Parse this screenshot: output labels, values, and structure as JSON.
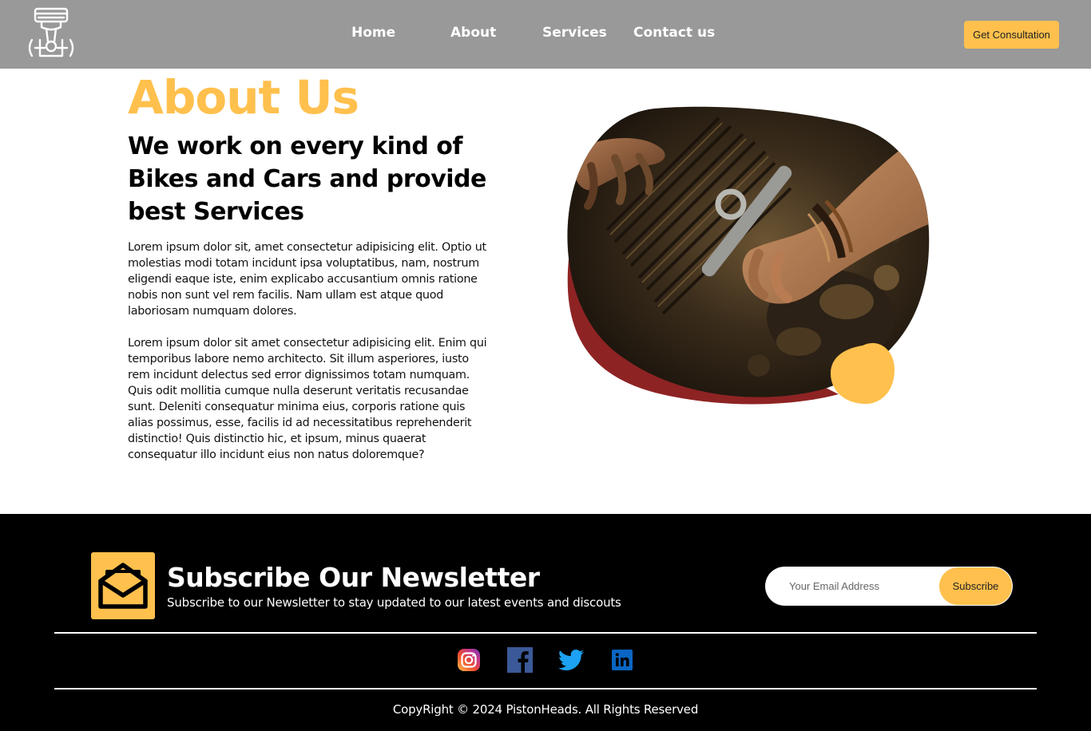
{
  "nav": {
    "logo_icon": "piston-engine-icon",
    "links": [
      "Home",
      "About",
      "Services",
      "Contact us"
    ],
    "cta_label": "Get Consultation"
  },
  "about": {
    "title": "About Us",
    "subtitle": "We work on every kind of Bikes and Cars and provide best Services",
    "paragraph1": "Lorem ipsum dolor sit, amet consectetur adipisicing elit. Optio ut molestias modi totam incidunt ipsa voluptatibus, nam, nostrum eligendi eaque iste, enim explicabo accusantium omnis ratione nobis non sunt vel rem facilis. Nam ullam est atque quod laboriosam numquam dolores.",
    "paragraph2": "Lorem ipsum dolor sit amet consectetur adipisicing elit. Enim qui temporibus labore nemo architecto. Sit illum asperiores, iusto rem incidunt delectus sed error dignissimos totam numquam. Quis odit mollitia cumque nulla deserunt veritatis recusandae sunt. Deleniti consequatur minima eius, corporis ratione quis alias possimus, esse, facilis id ad necessitatibus reprehenderit distinctio! Quis distinctio hic, et ipsum, minus quaerat consequatur illo incidunt eius non natus doloremque?",
    "image": "mechanic-engine-photo"
  },
  "newsletter": {
    "icon": "mail-icon",
    "title": "Subscribe Our Newsletter",
    "subtitle": "Subscribe to our Newsletter to stay updated to our latest events and discouts",
    "email_placeholder": "Your Email Address",
    "button_label": "Subscribe"
  },
  "social": [
    "instagram-icon",
    "facebook-icon",
    "twitter-icon",
    "linkedin-icon"
  ],
  "footer": {
    "copyright": "CopyRight © 2024 PistonHeads. All Rights Reserved"
  },
  "colors": {
    "nav_bg": "#999999",
    "accent": "#FFC04D",
    "blob_red": "#8E2323",
    "footer_bg": "#000000"
  }
}
